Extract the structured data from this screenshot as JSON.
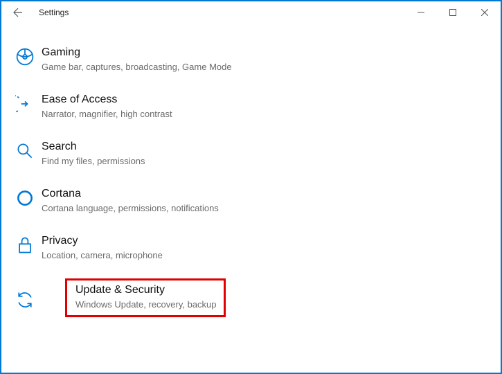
{
  "window": {
    "title": "Settings"
  },
  "items": [
    {
      "title": "Gaming",
      "desc": "Game bar, captures, broadcasting, Game Mode"
    },
    {
      "title": "Ease of Access",
      "desc": "Narrator, magnifier, high contrast"
    },
    {
      "title": "Search",
      "desc": "Find my files, permissions"
    },
    {
      "title": "Cortana",
      "desc": "Cortana language, permissions, notifications"
    },
    {
      "title": "Privacy",
      "desc": "Location, camera, microphone"
    },
    {
      "title": "Update & Security",
      "desc": "Windows Update, recovery, backup"
    }
  ]
}
